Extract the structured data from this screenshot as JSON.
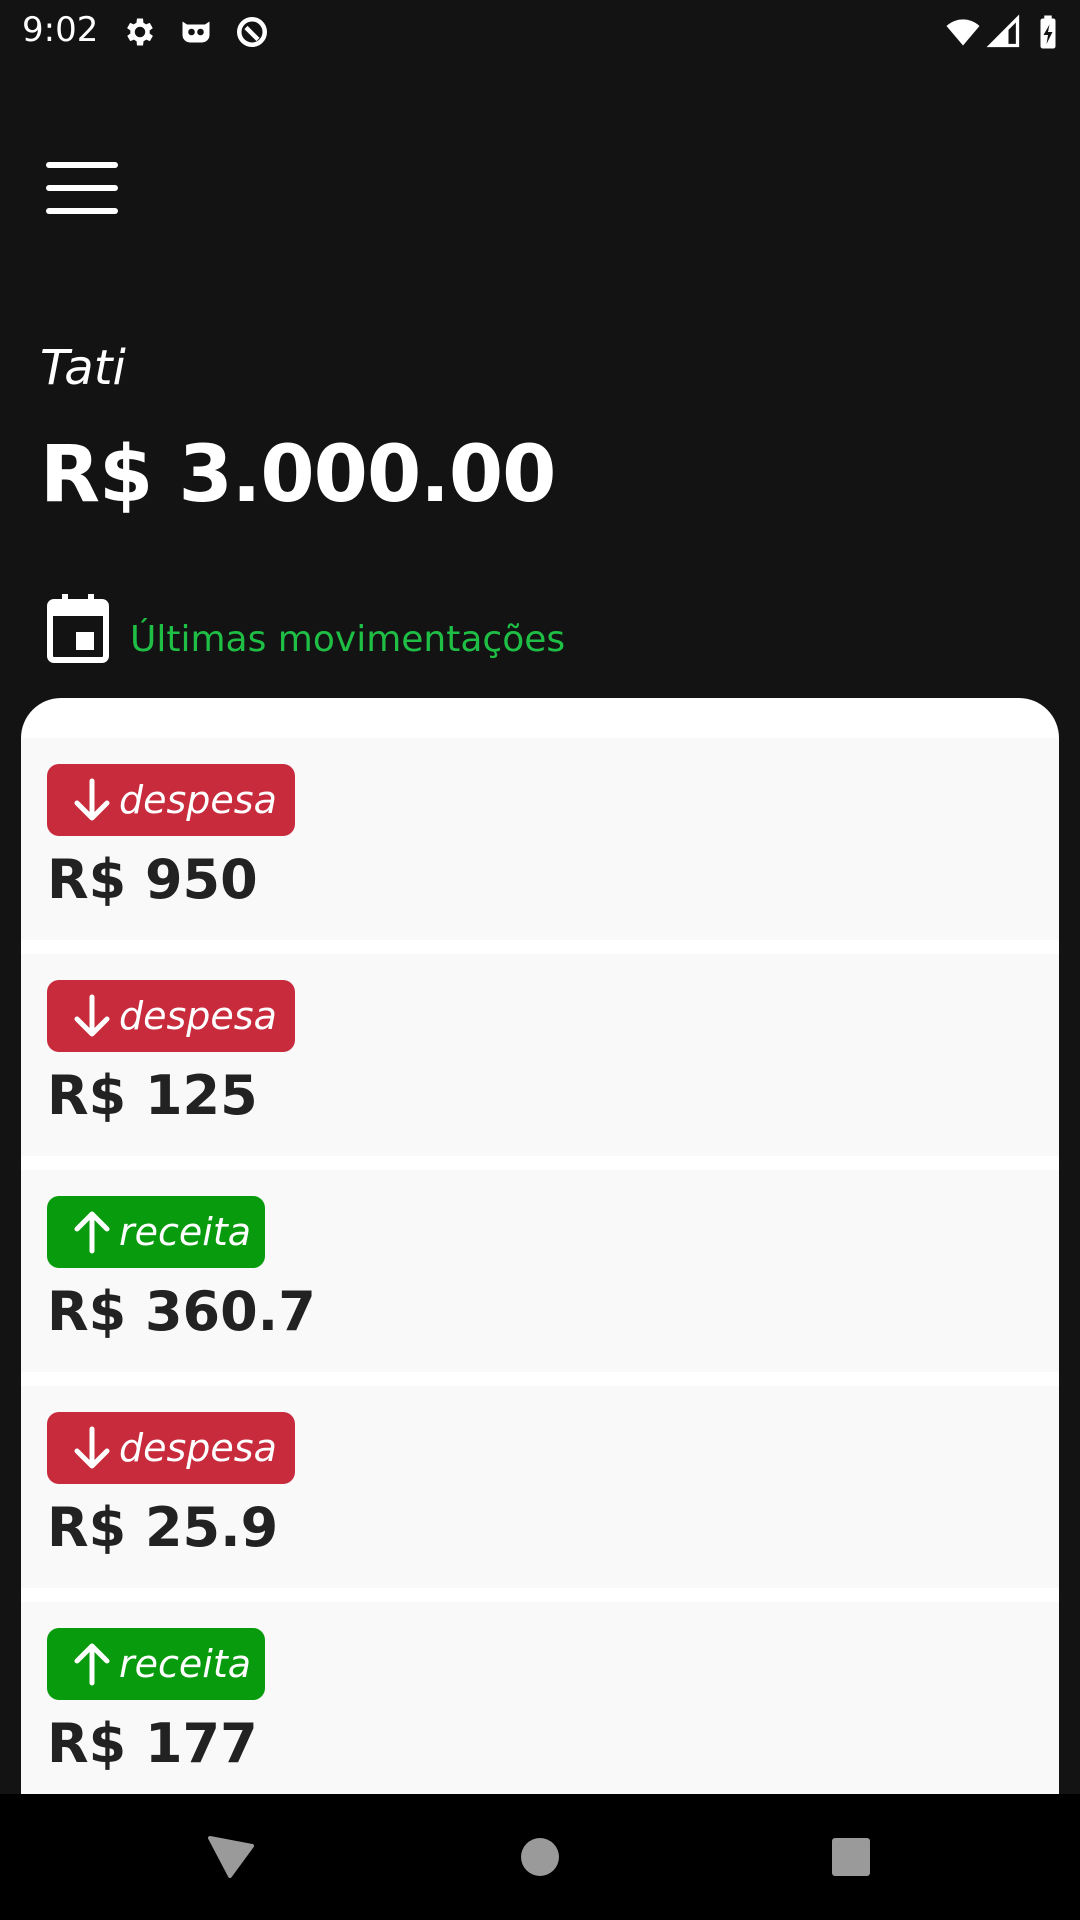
{
  "status_bar": {
    "time": "9:02",
    "left_icons": [
      "gear-icon",
      "mask-icon",
      "sync-icon"
    ],
    "right_icons": [
      "wifi-icon",
      "signal-icon",
      "battery-charging-icon"
    ]
  },
  "header": {
    "menu_icon": "hamburger-menu-icon",
    "user_name": "Tati",
    "balance": "R$ 3.000.00"
  },
  "section": {
    "icon": "calendar-icon",
    "title": "Últimas movimentações",
    "title_color": "#1fbf45"
  },
  "transactions": [
    {
      "type": "despesa",
      "direction": "down",
      "value": "R$ 950"
    },
    {
      "type": "despesa",
      "direction": "down",
      "value": "R$ 125"
    },
    {
      "type": "receita",
      "direction": "up",
      "value": "R$ 360.7"
    },
    {
      "type": "despesa",
      "direction": "down",
      "value": "R$ 25.9"
    },
    {
      "type": "receita",
      "direction": "up",
      "value": "R$ 177"
    }
  ],
  "colors": {
    "background": "#131313",
    "despesa": "#c82b3c",
    "receita": "#079b0d",
    "card": "#ffffff",
    "item": "#f9f9f9"
  },
  "nav_bar": {
    "buttons": [
      "back-icon",
      "home-icon",
      "recents-icon"
    ]
  }
}
